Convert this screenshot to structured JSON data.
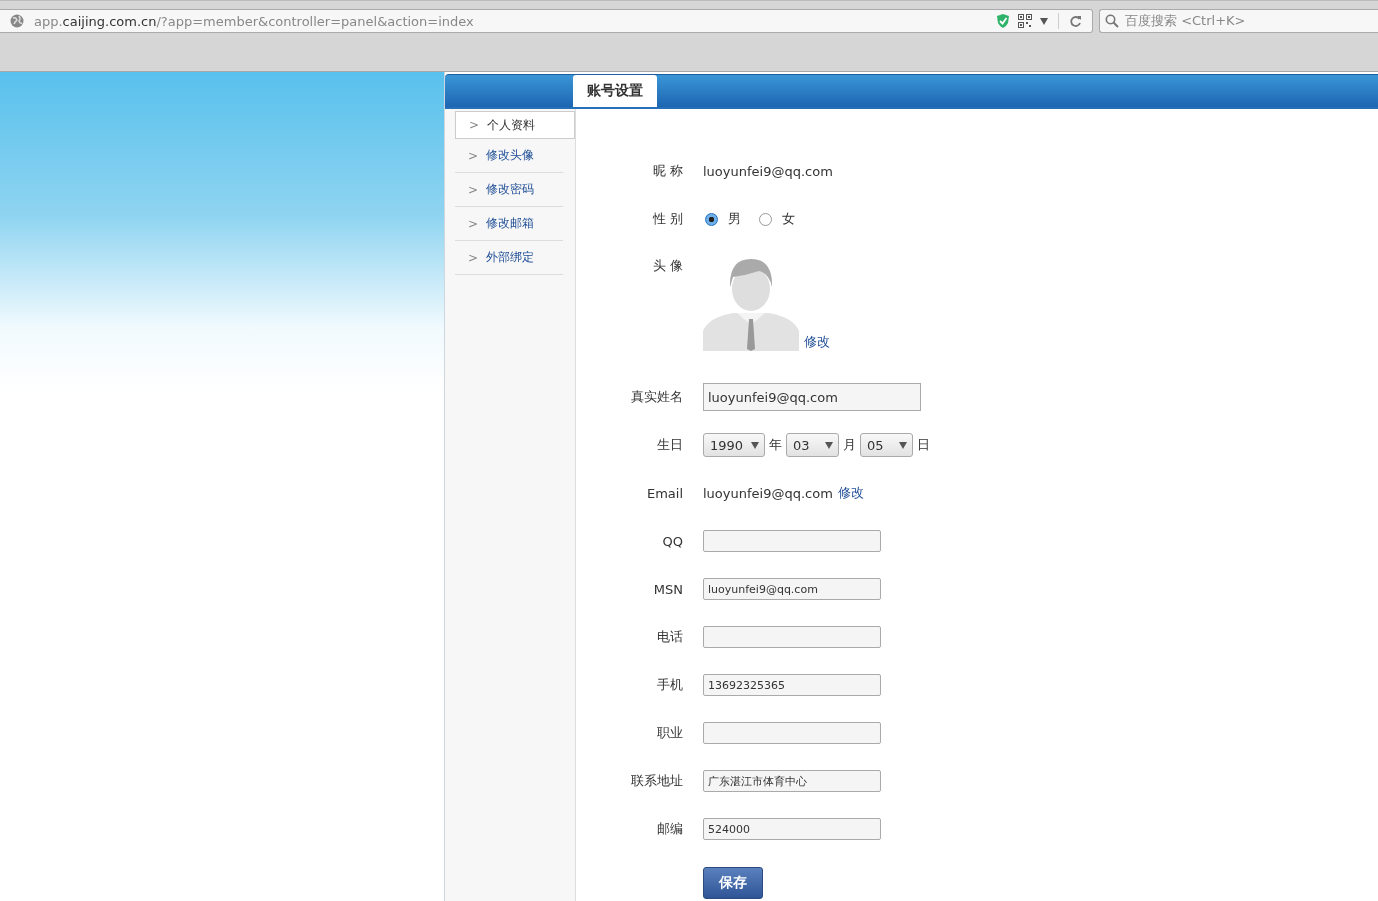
{
  "browser": {
    "url_host_prefix": "app.",
    "url_host": "caijing.com.cn",
    "url_path": "/?app=member&controller=panel&action=index",
    "search_placeholder": "百度搜索 <Ctrl+K>"
  },
  "tab": {
    "label": "账号设置",
    "selected": true
  },
  "sidebar": {
    "items": [
      {
        "label": "个人资料",
        "selected": true
      },
      {
        "label": "修改头像",
        "selected": false
      },
      {
        "label": "修改密码",
        "selected": false
      },
      {
        "label": "修改邮箱",
        "selected": false
      },
      {
        "label": "外部绑定",
        "selected": false
      }
    ],
    "arrow": ">"
  },
  "form": {
    "rows": [
      {
        "kind": "text",
        "label": "昵 称",
        "value": "luoyunfei9@qq.com"
      },
      {
        "kind": "radio",
        "label": "性 别",
        "options": [
          {
            "label": "男",
            "selected": true
          },
          {
            "label": "女",
            "selected": false
          }
        ]
      },
      {
        "kind": "avatar",
        "label": "头 像",
        "link": "修改"
      },
      {
        "kind": "wide_input",
        "label": "真实姓名",
        "value": "luoyunfei9@qq.com"
      },
      {
        "kind": "date",
        "label": "生日",
        "parts": [
          {
            "value": "1990",
            "unit": "年"
          },
          {
            "value": "03",
            "unit": "月"
          },
          {
            "value": "05",
            "unit": "日"
          }
        ]
      },
      {
        "kind": "text",
        "label": "Email",
        "value": "luoyunfei9@qq.com",
        "link": "修改"
      },
      {
        "kind": "input",
        "label": "QQ",
        "value": ""
      },
      {
        "kind": "input",
        "label": "MSN",
        "value": "luoyunfei9@qq.com"
      },
      {
        "kind": "input",
        "label": "电话",
        "value": ""
      },
      {
        "kind": "input",
        "label": "手机",
        "value": "13692325365"
      },
      {
        "kind": "input",
        "label": "职业",
        "value": ""
      },
      {
        "kind": "input",
        "label": "联系地址",
        "value": "广东湛江市体育中心"
      },
      {
        "kind": "input",
        "label": "邮编",
        "value": "524000"
      }
    ],
    "save_button": "保存"
  }
}
